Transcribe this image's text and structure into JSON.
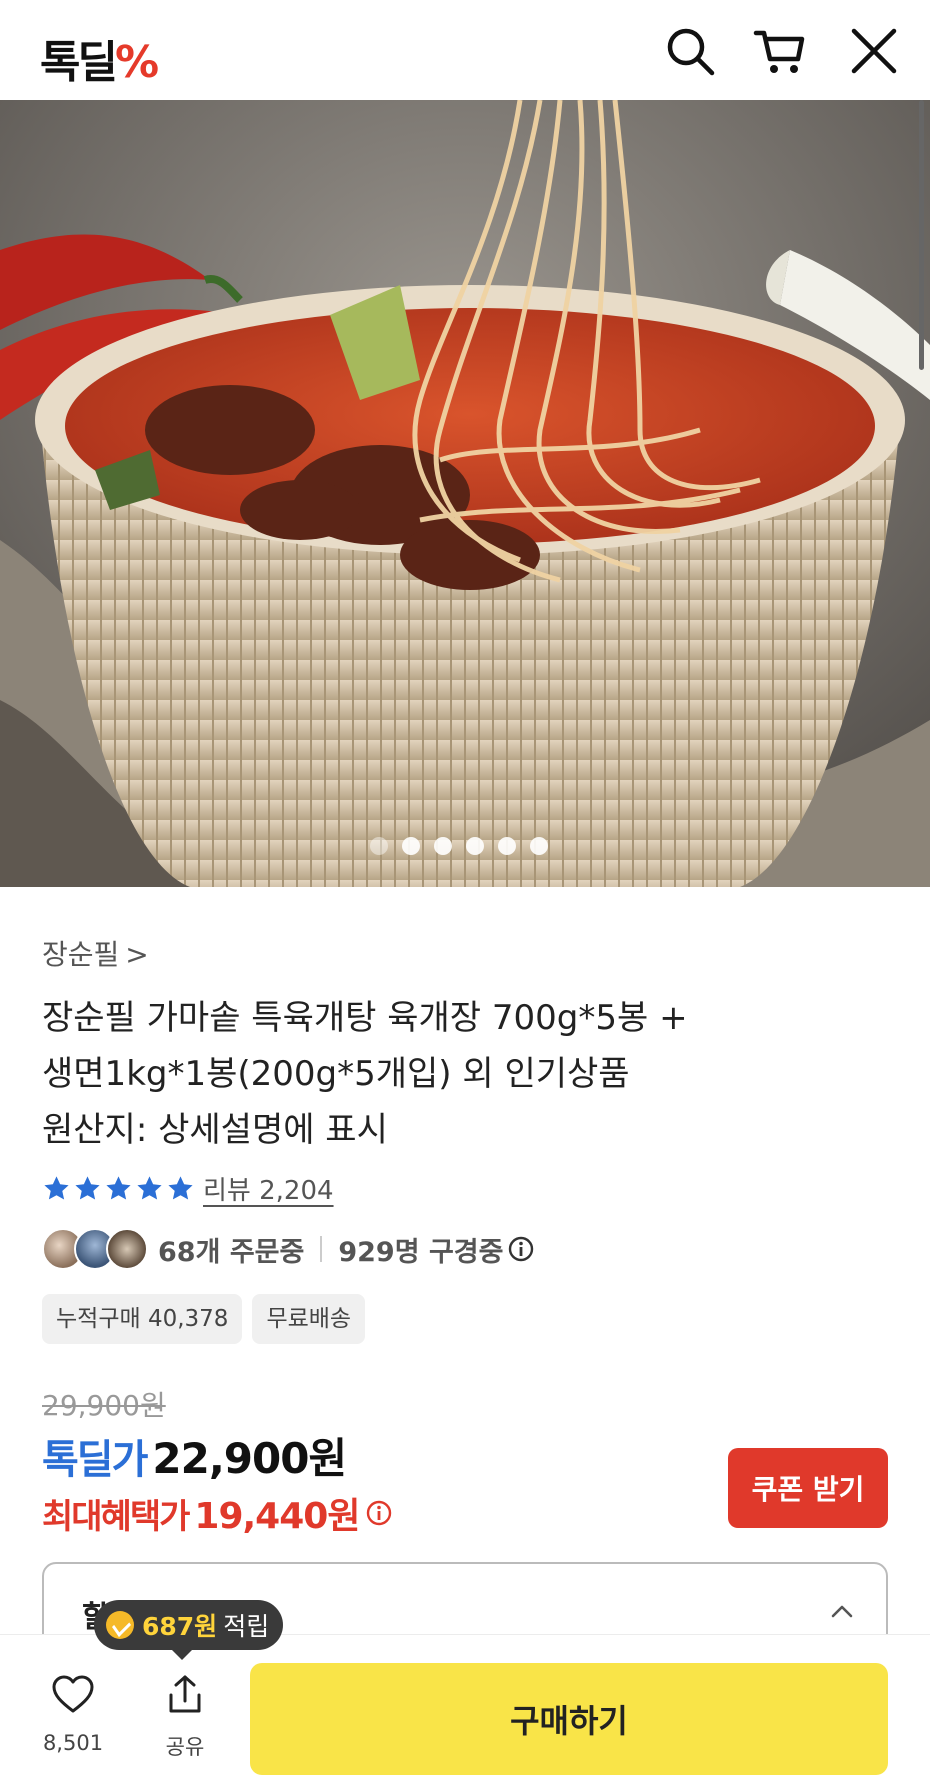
{
  "header": {
    "logo_text": "톡딜",
    "logo_mark": "%",
    "icons": [
      "search-icon",
      "cart-icon",
      "close-icon"
    ]
  },
  "hero": {
    "image_count": 6,
    "active_index": 0
  },
  "product": {
    "brand": "장순필",
    "brand_chevron": ">",
    "title_lines": [
      "장순필 가마솥 특육개탕 육개장 700g*5봉 +",
      "생면1kg*1봉(200g*5개입) 외 인기상품",
      "원산지: 상세설명에 표시"
    ],
    "rating_stars": 5,
    "review_label": "리뷰 2,204",
    "ordering": "68개 주문중",
    "viewing": "929명 구경중",
    "chips": [
      "누적구매 40,378",
      "무료배송"
    ]
  },
  "price": {
    "original": "29,900원",
    "deal_label": "톡딜가",
    "deal_price": "22,900원",
    "max_label": "최대혜택가",
    "max_price": "19,440원",
    "coupon_button": "쿠폰 받기"
  },
  "accordion": {
    "title": "할인 & 적립"
  },
  "tooltip": {
    "amount": "687원",
    "label": "적립"
  },
  "bottom_bar": {
    "like_count": "8,501",
    "share_label": "공유",
    "buy_button": "구매하기"
  },
  "colors": {
    "brand_red": "#e0392b",
    "deal_blue": "#2b6fd6",
    "buy_yellow": "#f9e448",
    "star_blue": "#2b6fd6"
  }
}
